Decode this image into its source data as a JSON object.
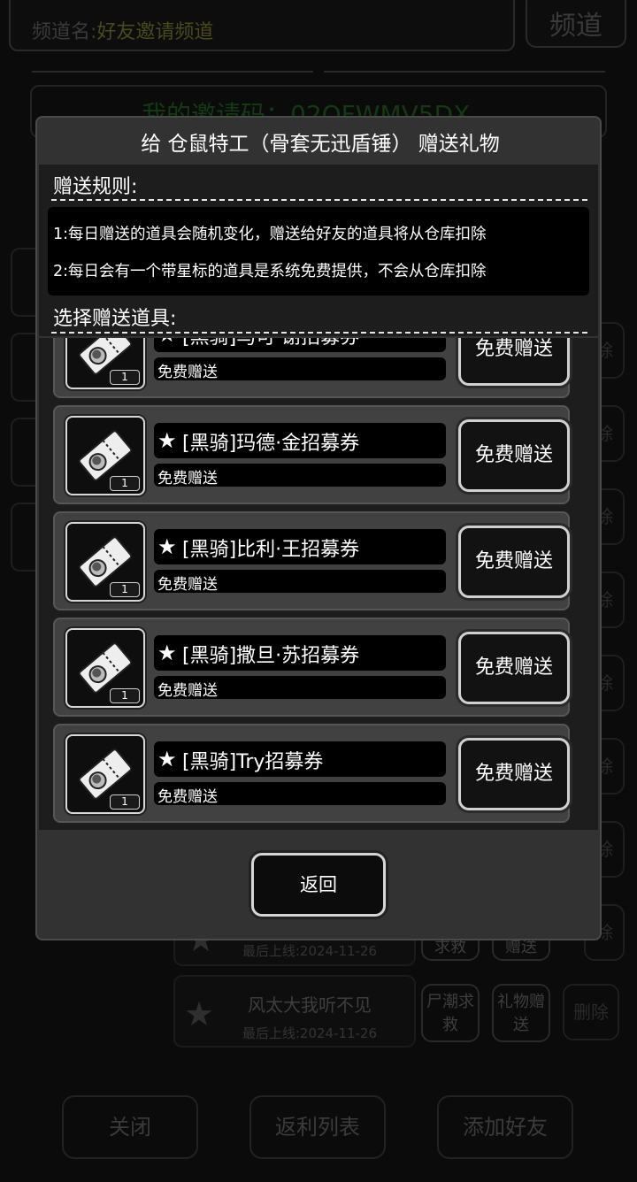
{
  "background": {
    "channel_label": "频道名:",
    "channel_value": "好友邀请频道",
    "channel_button": "频道",
    "invite_code": "我的邀请码：02QFWMV5DX",
    "delete_label": "除",
    "friends": [
      {
        "name": "",
        "last_online": "最后上线:2024-11-26",
        "btn1": "求救",
        "btn2": "赠送",
        "btn3": "除"
      },
      {
        "name": "风太大我听不见",
        "last_online": "最后上线:2024-11-26",
        "btn1": "尸潮求救",
        "btn2": "礼物赠送",
        "btn3": "删除"
      }
    ],
    "bottom_buttons": [
      "关闭",
      "返利列表",
      "添加好友"
    ]
  },
  "dialog": {
    "title": "给 仓鼠特工（骨套无迅盾锤） 赠送礼物",
    "rules_title": "赠送规则:",
    "rules": [
      "1:每日赠送的道具会随机变化，赠送给好友的道具将从仓库扣除",
      "2:每日会有一个带星标的道具是系统免费提供，不会从仓库扣除"
    ],
    "select_title": "选择赠送道具:",
    "items": [
      {
        "name": "[黑骑]马可·谢招募券",
        "sub": "免费赠送",
        "count": "1",
        "button": "免费赠送"
      },
      {
        "name": "[黑骑]玛德·金招募券",
        "sub": "免费赠送",
        "count": "1",
        "button": "免费赠送"
      },
      {
        "name": "[黑骑]比利·王招募券",
        "sub": "免费赠送",
        "count": "1",
        "button": "免费赠送"
      },
      {
        "name": "[黑骑]撒旦·苏招募券",
        "sub": "免费赠送",
        "count": "1",
        "button": "免费赠送"
      },
      {
        "name": "[黑骑]Try招募券",
        "sub": "免费赠送",
        "count": "1",
        "button": "免费赠送"
      }
    ],
    "back_button": "返回"
  },
  "icons": {
    "star": "star-icon",
    "ticket": "ticket-icon"
  }
}
